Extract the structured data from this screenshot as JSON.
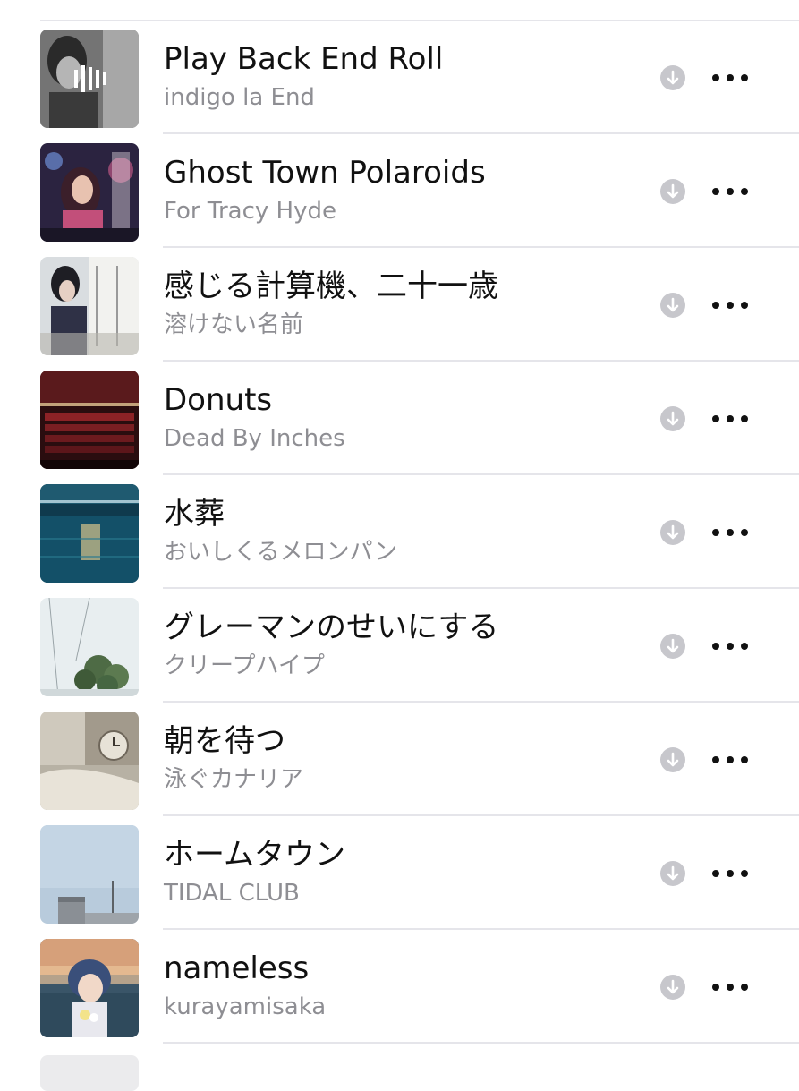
{
  "songs": [
    {
      "title": "Play Back End Roll",
      "artist": "indigo la End",
      "art": "art-bw-portrait"
    },
    {
      "title": "Ghost Town Polaroids",
      "artist": "For Tracy Hyde",
      "art": "art-night-portrait"
    },
    {
      "title": "感じる計算機、二十一歳",
      "artist": "溶けない名前",
      "art": "art-window-girl"
    },
    {
      "title": "Donuts",
      "artist": "Dead By Inches",
      "art": "art-theater"
    },
    {
      "title": "水葬",
      "artist": "おいしくるメロンパン",
      "art": "art-pool"
    },
    {
      "title": "グレーマンのせいにする",
      "artist": "クリープハイプ",
      "art": "art-plants"
    },
    {
      "title": "朝を待つ",
      "artist": "泳ぐカナリア",
      "art": "art-clock"
    },
    {
      "title": "ホームタウン",
      "artist": "TIDAL CLUB",
      "art": "art-sky"
    },
    {
      "title": "nameless",
      "artist": "kurayamisaka",
      "art": "art-anime-girl"
    }
  ],
  "icons": {
    "download": "download-icon",
    "more": "more-icon"
  },
  "colors": {
    "title": "#111111",
    "subtitle": "#8e8e93",
    "separator": "#e5e5ea",
    "download_bg": "#c7c7cc"
  }
}
